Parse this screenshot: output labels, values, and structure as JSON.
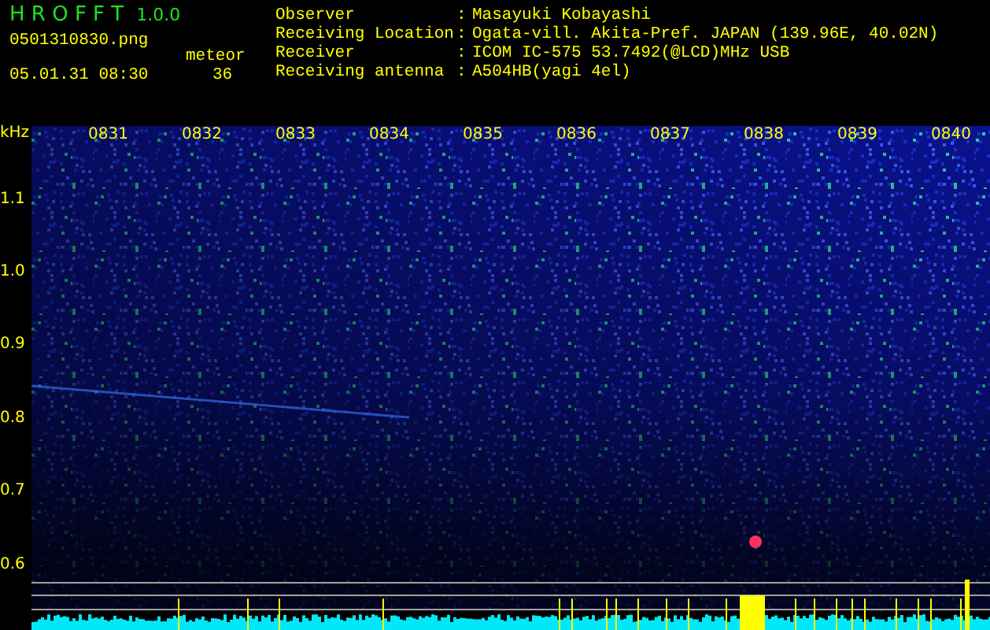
{
  "app": {
    "title_letters": [
      "H",
      "R",
      "O",
      "F",
      "F",
      "T"
    ],
    "version": "1.0.0"
  },
  "file_name": "0501310830.png",
  "date_time": "05.01.31 08:30",
  "meteor": {
    "label": "meteor",
    "count": "36"
  },
  "info": [
    {
      "label": "Observer",
      "separator": ":",
      "value": "Masayuki Kobayashi"
    },
    {
      "label": "Receiving Location",
      "separator": ":",
      "value": "Ogata-vill. Akita-Pref. JAPAN (139.96E, 40.02N)"
    },
    {
      "label": "Receiver",
      "separator": ":",
      "value": "ICOM IC-575 53.7492(@LCD)MHz USB"
    },
    {
      "label": "Receiving antenna",
      "separator": ":",
      "value": "A504HB(yagi 4el)"
    }
  ],
  "frequency_axis": {
    "unit": "kHz",
    "labels": [
      "1.1",
      "1.0",
      "0.9",
      "0.8",
      "0.7",
      "0.6"
    ]
  },
  "time_labels": [
    "0831",
    "0832",
    "0833",
    "0834",
    "0835",
    "0836",
    "0837",
    "0838",
    "0839",
    "0840"
  ]
}
